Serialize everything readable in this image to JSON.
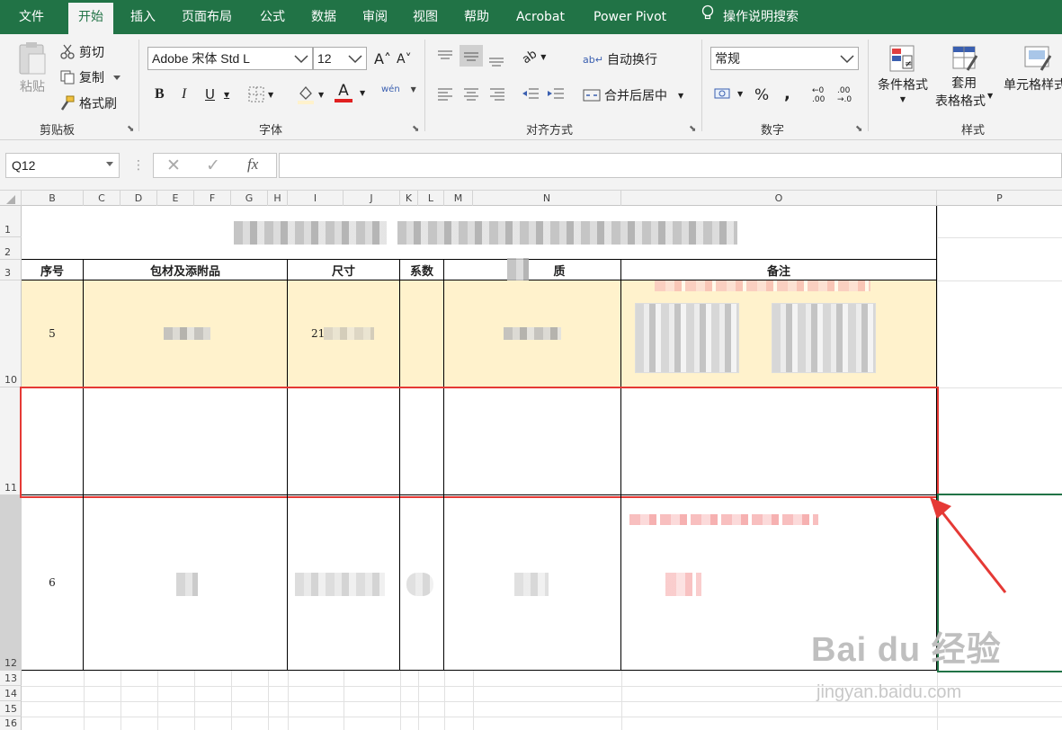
{
  "tabs": {
    "items": [
      {
        "label": "文件"
      },
      {
        "label": "开始"
      },
      {
        "label": "插入"
      },
      {
        "label": "页面布局"
      },
      {
        "label": "公式"
      },
      {
        "label": "数据"
      },
      {
        "label": "审阅"
      },
      {
        "label": "视图"
      },
      {
        "label": "帮助"
      },
      {
        "label": "Acrobat"
      },
      {
        "label": "Power Pivot"
      }
    ],
    "search_label": "操作说明搜索"
  },
  "ribbon": {
    "clipboard": {
      "paste": "粘贴",
      "cut": "剪切",
      "copy": "复制",
      "format_painter": "格式刷",
      "group": "剪贴板"
    },
    "font": {
      "name": "Adobe 宋体 Std L",
      "size": "12",
      "bold": "B",
      "italic": "I",
      "underline": "U",
      "font_color": "A",
      "phonetic": "wén",
      "group": "字体"
    },
    "alignment": {
      "wrap": "自动换行",
      "merge": "合并后居中",
      "group": "对齐方式"
    },
    "number": {
      "format": "常规",
      "percent": "%",
      "comma": ",",
      "group": "数字"
    },
    "styles": {
      "conditional": "条件格式",
      "table_line1": "套用",
      "table_line2": "表格格式",
      "cell_styles": "单元格样式",
      "group": "样式"
    }
  },
  "formula_bar": {
    "name_box": "Q12",
    "fx": "fx",
    "value": ""
  },
  "columns": [
    "B",
    "C",
    "D",
    "E",
    "F",
    "G",
    "H",
    "I",
    "J",
    "K",
    "L",
    "M",
    "N",
    "O",
    "P"
  ],
  "rows": [
    "1",
    "2",
    "3",
    "10",
    "11",
    "12",
    "13",
    "14",
    "15",
    "16"
  ],
  "table": {
    "headers": {
      "seq": "序号",
      "material": "包材及添附品",
      "size": "尺寸",
      "coef": "系数",
      "quality": "质",
      "remark": "备注"
    },
    "row10": {
      "seq": "5",
      "size_prefix": "21"
    },
    "row12": {
      "seq": "6"
    }
  },
  "watermark": {
    "brand": "Bai du 经验",
    "url": "jingyan.baidu.com"
  },
  "colors": {
    "accent": "#217346",
    "highlight_fill": "#fff2cc",
    "annotation_red": "#e53935"
  }
}
